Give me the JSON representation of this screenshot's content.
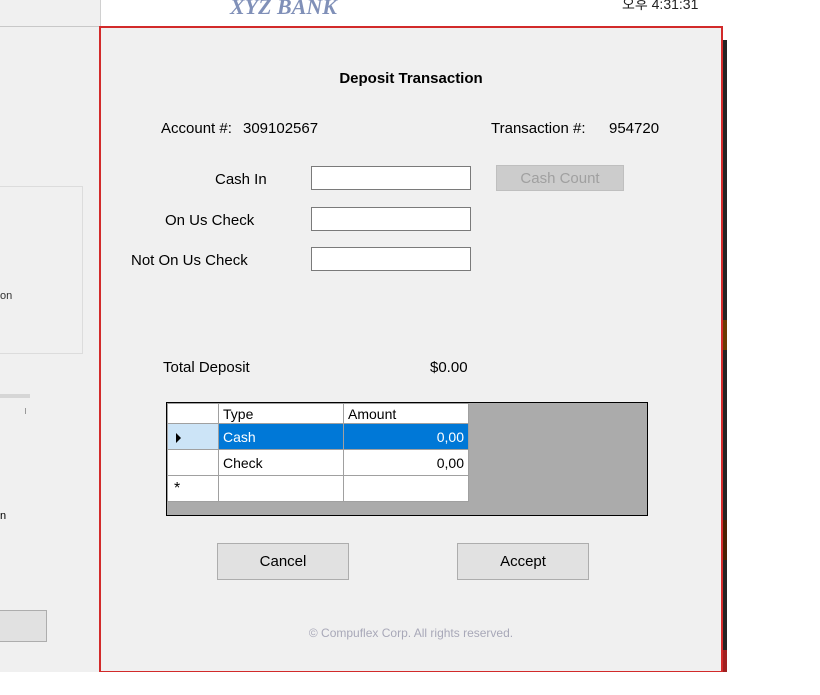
{
  "header": {
    "bank_name": "XYZ BANK",
    "clock": "오후 4:31:31"
  },
  "background_window": {
    "partial_text_on": "on",
    "partial_text_n": "n"
  },
  "dialog": {
    "title": "Deposit Transaction",
    "account_label": "Account #:",
    "account_value": "309102567",
    "transaction_label": "Transaction #:",
    "transaction_value": "954720",
    "fields": {
      "cash_in_label": "Cash In",
      "cash_in_value": "",
      "on_us_check_label": "On Us Check",
      "on_us_check_value": "",
      "not_on_us_check_label": "Not On Us Check",
      "not_on_us_check_value": ""
    },
    "cash_count_button": "Cash Count",
    "total_label": "Total Deposit",
    "total_value": "$0.00",
    "grid": {
      "columns": [
        "Type",
        "Amount"
      ],
      "rows": [
        {
          "type": "Cash",
          "amount": "0,00",
          "selected": true
        },
        {
          "type": "Check",
          "amount": "0,00",
          "selected": false
        }
      ],
      "new_row_marker": "*"
    },
    "cancel_button": "Cancel",
    "accept_button": "Accept",
    "copyright": "© Compuflex Corp. All rights reserved."
  },
  "colors": {
    "dialog_border": "#d22a2a",
    "selection": "#0078d7"
  }
}
